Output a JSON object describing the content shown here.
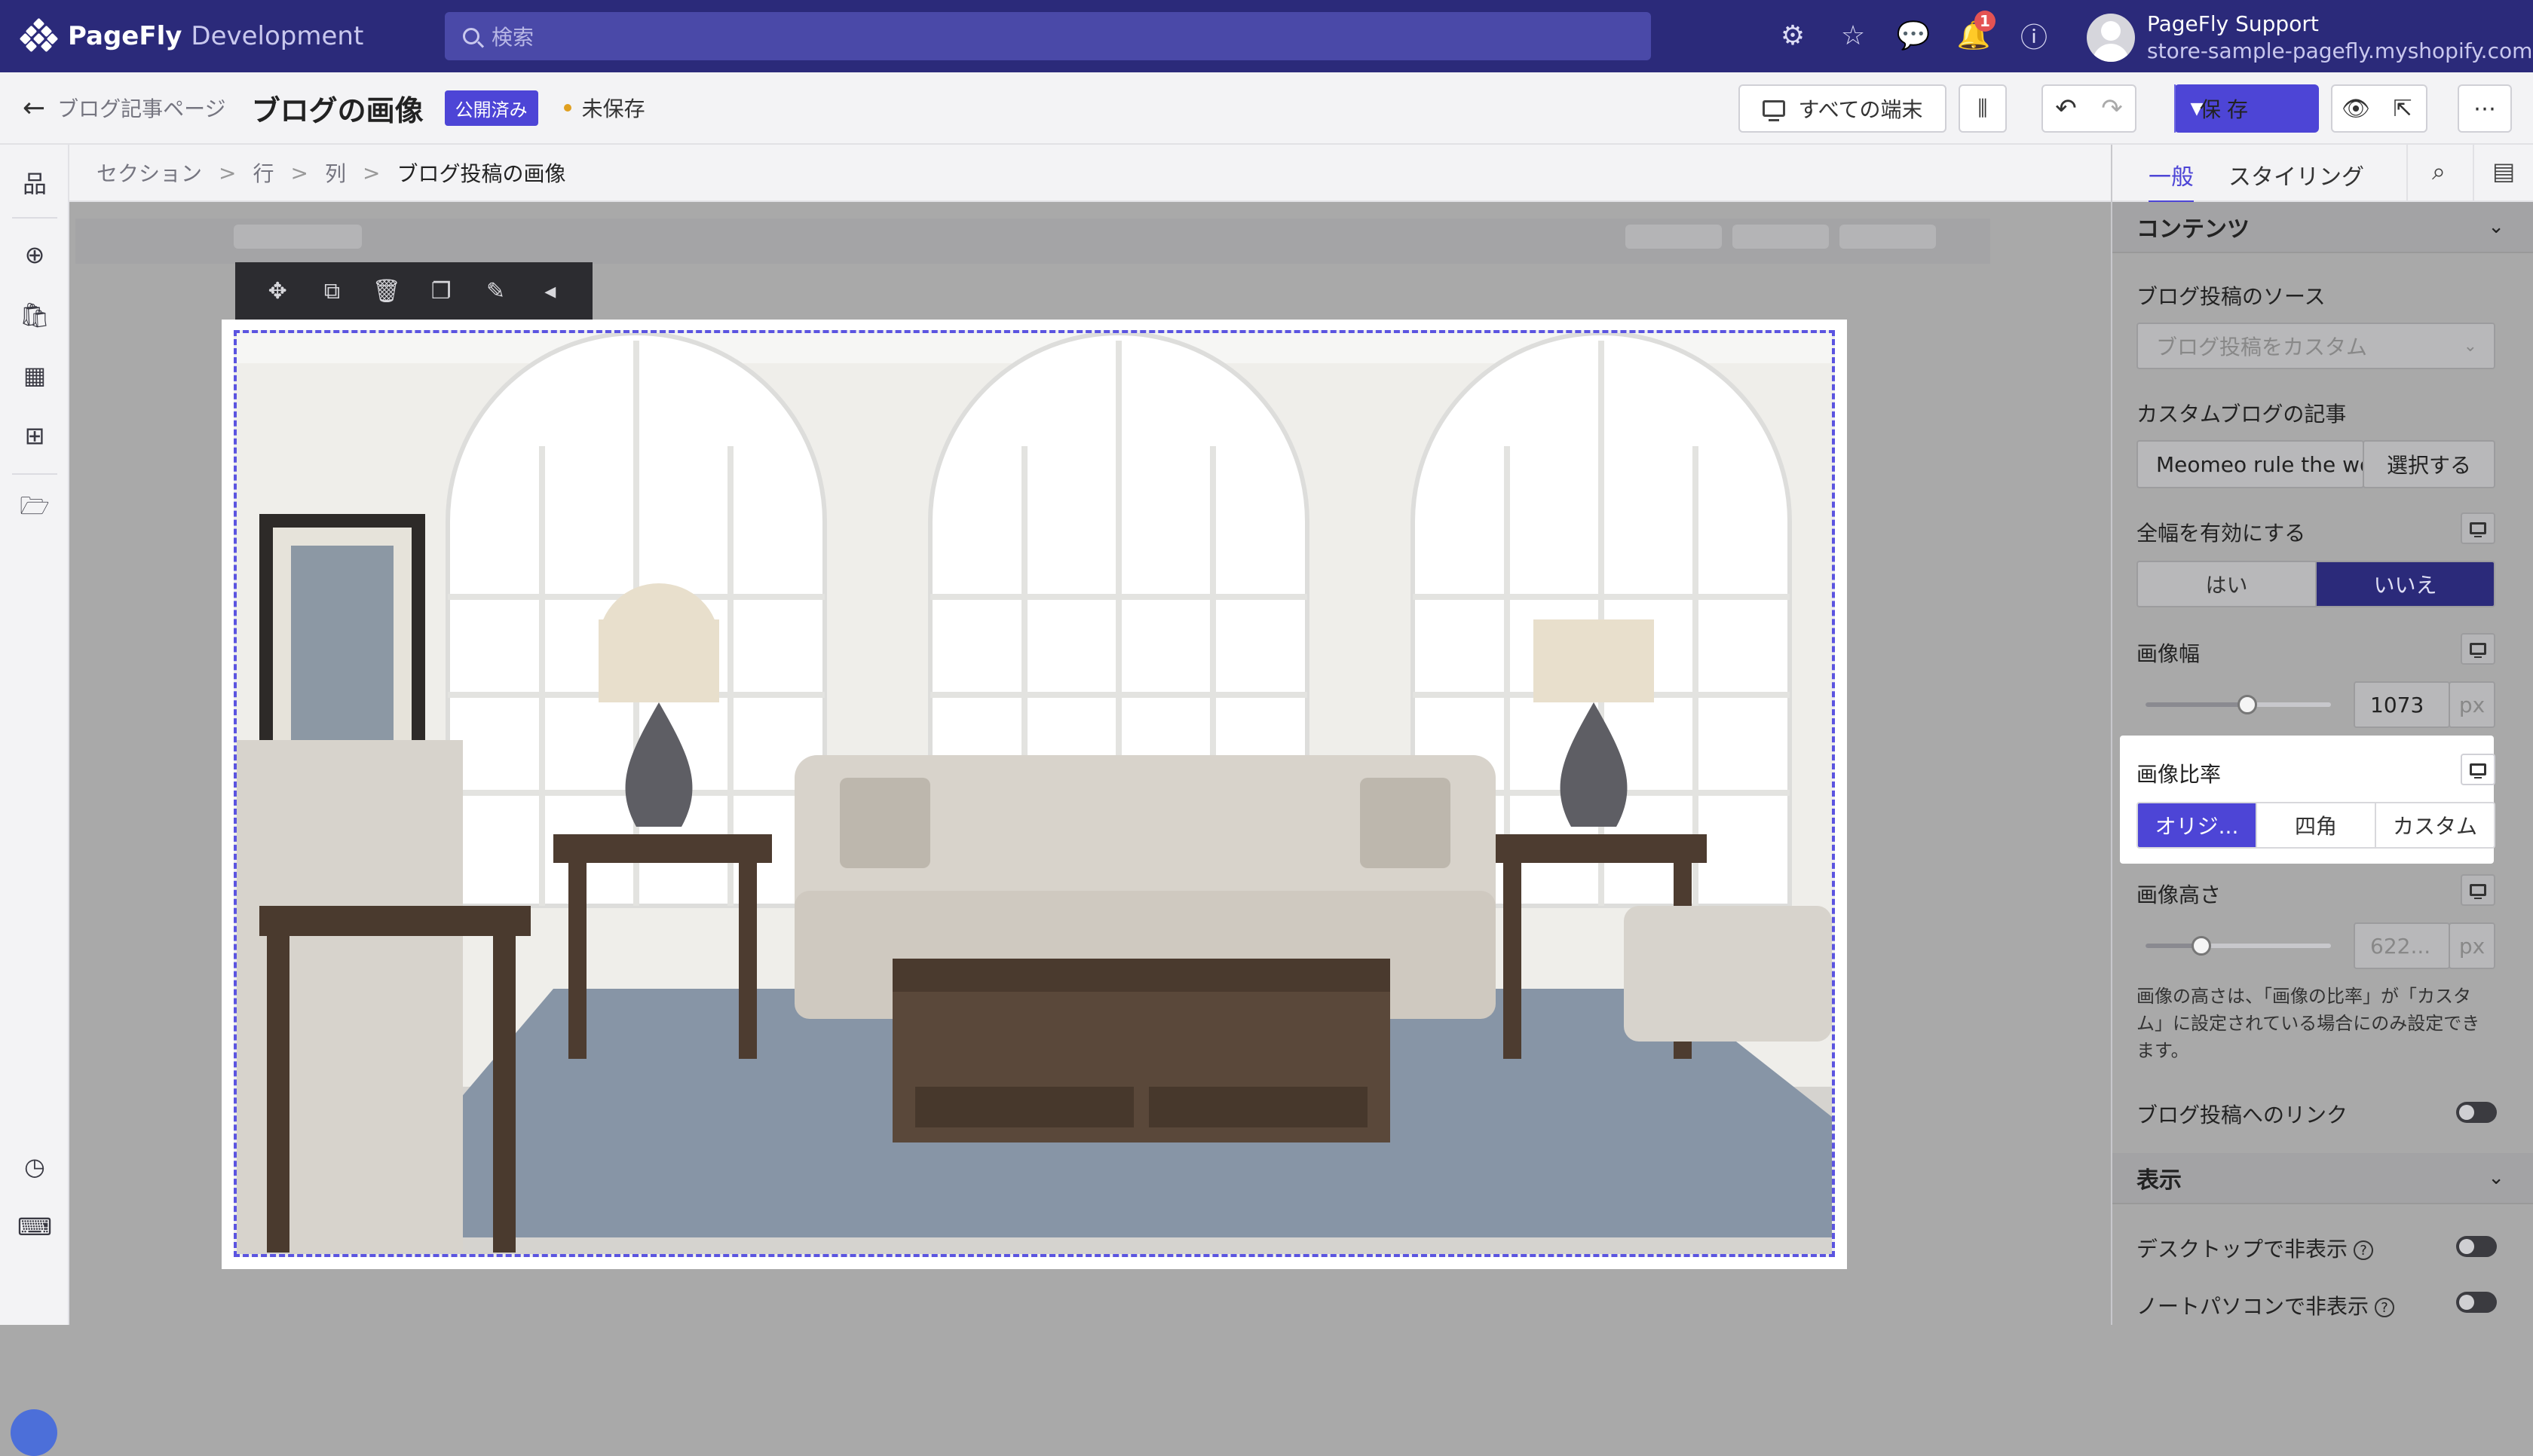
{
  "app": {
    "brand": "PageFly",
    "env": "Development"
  },
  "search": {
    "placeholder": "検索"
  },
  "notifications": {
    "count": "1"
  },
  "user": {
    "name": "PageFly Support",
    "store": "store-sample-pagefly.myshopify.com"
  },
  "subbar": {
    "back_label": "ブログ記事ページ",
    "title": "ブログの画像",
    "status": "公開済み",
    "unsaved": "未保存",
    "device_label": "すべての端末",
    "save_label": "保存"
  },
  "breadcrumb": {
    "items": [
      "セクション",
      "行",
      "列"
    ],
    "current": "ブログ投稿の画像"
  },
  "panel": {
    "tabs": {
      "general": "一般",
      "styling": "スタイリング"
    },
    "content_section": "コンテンツ",
    "source_label": "ブログ投稿のソース",
    "source_value": "ブログ投稿をカスタム",
    "custom_label": "カスタムブログの記事",
    "custom_value": "Meomeo rule the wo",
    "select_button": "選択する",
    "full_width_label": "全幅を有効にする",
    "full_width_options": [
      "はい",
      "いいえ"
    ],
    "image_width_label": "画像幅",
    "image_width_value": "1073",
    "unit_px": "px",
    "image_ratio_label": "画像比率",
    "image_ratio_options": [
      "オリジ...",
      "四角",
      "カスタム"
    ],
    "image_height_label": "画像高さ",
    "image_height_value": "622...",
    "height_help": "画像の高さは、「画像の比率」が「カスタム」に設定されている場合にのみ設定できます。",
    "link_label": "ブログ投稿へのリンク",
    "display_section": "表示",
    "hide_desktop": "デスクトップで非表示",
    "hide_laptop": "ノートパソコンで非表示"
  },
  "controls": {
    "image_width_fraction": 0.55,
    "image_height_fraction": 0.3
  },
  "colors": {
    "topbar": "#2b2a7a",
    "accent": "#4d45d6",
    "selection": "#5b54e0"
  }
}
